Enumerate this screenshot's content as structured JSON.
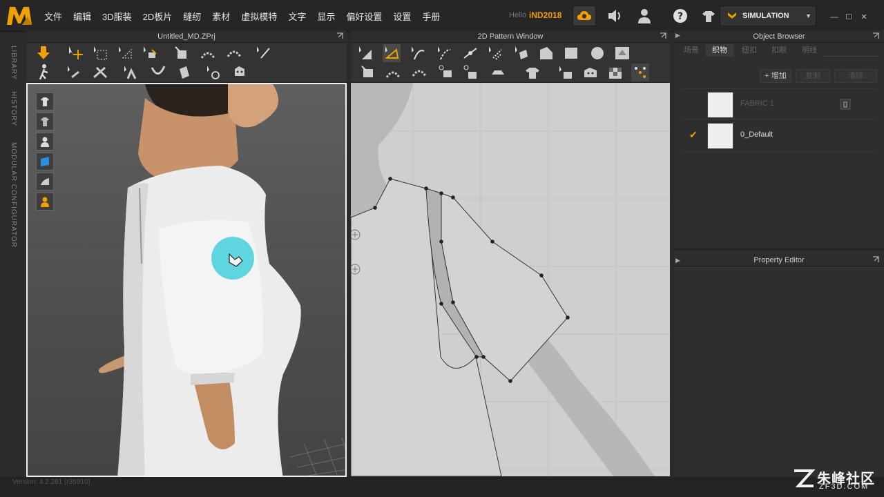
{
  "menu": [
    "文件",
    "编辑",
    "3D服装",
    "2D板片",
    "缝纫",
    "素材",
    "虚拟模特",
    "文字",
    "显示",
    "偏好设置",
    "设置",
    "手册"
  ],
  "user": {
    "hello": "Hello",
    "name": "iND2018"
  },
  "simulation": {
    "label": "SIMULATION"
  },
  "panels": {
    "viewport3d_title": "Untitled_MD.ZPrj",
    "pattern_title": "2D Pattern Window",
    "object_browser_title": "Object Browser",
    "property_editor_title": "Property Editor"
  },
  "sidebar_tabs": [
    "LIBRARY",
    "HISTORY",
    "MODULAR CONFIGURATOR"
  ],
  "object_browser": {
    "tabs": [
      "场景",
      "织物",
      "纽扣",
      "扣眼",
      "明线"
    ],
    "active_tab": 1,
    "buttons": [
      "+ 增加",
      "复制",
      "清除"
    ],
    "fabrics": [
      {
        "name": "FABRIC 1",
        "selected": false
      },
      {
        "name": "0_Default",
        "selected": true
      }
    ]
  },
  "status": {
    "version": "Version: 4.2.281 (r35910)"
  },
  "watermark": {
    "text": "朱峰社区",
    "sub": "ZF3D.COM"
  },
  "colors": {
    "accent": "#f0a000",
    "cursor": "#4fd3dd"
  }
}
